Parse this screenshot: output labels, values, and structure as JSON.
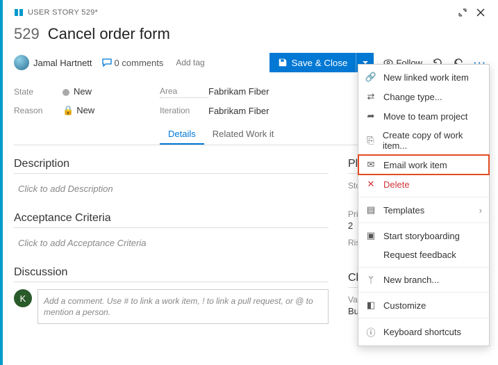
{
  "header": {
    "type_label": "USER STORY 529*",
    "id": "529",
    "title": "Cancel order form"
  },
  "assignee": {
    "name": "Jamal Hartnett"
  },
  "comments": {
    "count_label": "0 comments"
  },
  "add_tag_placeholder": "Add tag",
  "save_button": "Save & Close",
  "follow_label": "Follow",
  "state": {
    "state_label": "State",
    "state_value": "New",
    "reason_label": "Reason",
    "reason_value": "New",
    "area_label": "Area",
    "area_value": "Fabrikam Fiber",
    "iteration_label": "Iteration",
    "iteration_value": "Fabrikam Fiber"
  },
  "tabs": {
    "details": "Details",
    "related": "Related Work it"
  },
  "sections": {
    "description": {
      "heading": "Description",
      "placeholder": "Click to add Description"
    },
    "acceptance": {
      "heading": "Acceptance Criteria",
      "placeholder": "Click to add Acceptance Criteria"
    },
    "discussion": {
      "heading": "Discussion",
      "avatar_initial": "K",
      "placeholder": "Add a comment. Use # to link a work item, ! to link a pull request, or @ to mention a person."
    }
  },
  "planning": {
    "heading": "Planning",
    "story_points_label": "Story Points",
    "priority_label": "Priority",
    "priority_value": "2",
    "risk_label": "Risk"
  },
  "classification": {
    "heading": "Classificati",
    "value_area_label": "Value area",
    "value_area_value": "Business"
  },
  "context_menu": {
    "new_linked": "New linked work item",
    "change_type": "Change type...",
    "move_team": "Move to team project",
    "create_copy": "Create copy of work item...",
    "email": "Email work item",
    "delete": "Delete",
    "templates": "Templates",
    "storyboard": "Start storyboarding",
    "feedback": "Request feedback",
    "new_branch": "New branch...",
    "customize": "Customize",
    "shortcuts": "Keyboard shortcuts"
  }
}
